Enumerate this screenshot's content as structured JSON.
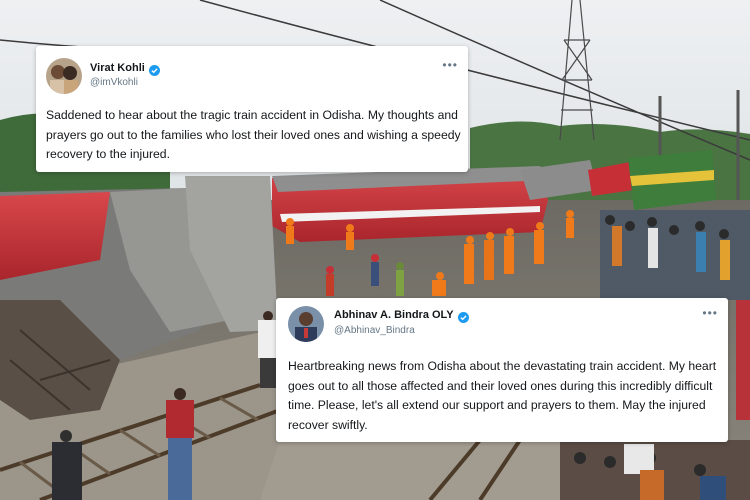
{
  "tweets": [
    {
      "display_name": "Virat Kohli",
      "handle": "@imVkohli",
      "text": "Saddened to hear about the tragic train accident in Odisha. My thoughts and prayers go out to the families who lost their loved ones and wishing a speedy recovery to the injured.",
      "verified": true
    },
    {
      "display_name": "Abhinav A. Bindra OLY",
      "handle": "@Abhinav_Bindra",
      "text": "Heartbreaking news from Odisha about the devastating train accident. My heart goes out to all those affected and their loved ones during this incredibly difficult time. Please, let's all extend our support and prayers to them. May the injured recover swiftly.",
      "verified": true
    }
  ],
  "colors": {
    "verified_badge": "#1d9bf0",
    "coach_red": "#c62f36",
    "rescue_orange": "#f07a1a",
    "engine_green": "#3e7d3b"
  },
  "icons": [
    "verified-badge-icon",
    "more-options-icon"
  ]
}
